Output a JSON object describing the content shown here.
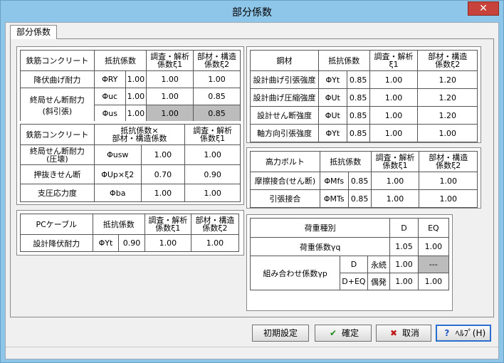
{
  "window": {
    "title": "部分係数",
    "close": "✕"
  },
  "tab": {
    "label": "部分係数"
  },
  "rc1": {
    "h": [
      "鉄筋コンクリート",
      "抵抗係数",
      "調査・解析\n係数ξ1",
      "部材・構造\n係数ξ2"
    ],
    "r1": [
      "降伏曲げ耐力",
      "ΦRY",
      "1.00",
      "1.00",
      "1.00"
    ],
    "r2label": "終局せん断耐力\n(斜引張)",
    "r2a": [
      "Φuc",
      "1.00",
      "1.00",
      "0.85"
    ],
    "r2b": [
      "Φus",
      "1.00",
      "1.00",
      "0.85"
    ]
  },
  "rc2": {
    "h": [
      "鉄筋コンクリート",
      "抵抗係数×\n部材・構造係数",
      "調査・解析\n係数ξ1"
    ],
    "r1": [
      "終局せん断耐力\n(圧壊)",
      "Φusw",
      "1.00",
      "1.00"
    ],
    "r2": [
      "押抜きせん断",
      "ΦUp×ξ2",
      "0.70",
      "0.90"
    ],
    "r3": [
      "支圧応力度",
      "Φba",
      "1.00",
      "1.00"
    ]
  },
  "pc": {
    "h": [
      "PCケーブル",
      "抵抗係数",
      "調査・解析\n係数ξ1",
      "部材・構造\n係数ξ2"
    ],
    "r1": [
      "設計降伏耐力",
      "ΦYt",
      "0.90",
      "1.00",
      "1.00"
    ]
  },
  "steel": {
    "h": [
      "鋼材",
      "抵抗係数",
      "調査・解析\nξ1",
      "部材・構造\n係数ξ2"
    ],
    "r1": [
      "設計曲げ引張強度",
      "ΦYt",
      "0.85",
      "1.00",
      "1.20"
    ],
    "r2": [
      "設計曲げ圧縮強度",
      "ΦUt",
      "0.85",
      "1.00",
      "1.20"
    ],
    "r3": [
      "設計せん断強度",
      "ΦUt",
      "0.85",
      "1.00",
      "1.20"
    ],
    "r4": [
      "軸方向引張強度",
      "ΦYt",
      "0.85",
      "1.00",
      "1.00"
    ]
  },
  "bolt": {
    "h": [
      "高力ボルト",
      "抵抗係数",
      "調査・解析\n係数ξ1",
      "部材・構造\n係数ξ2"
    ],
    "r1": [
      "摩擦接合(せん断)",
      "ΦMfs",
      "0.85",
      "1.00",
      "1.00"
    ],
    "r2": [
      "引張接合",
      "ΦMTs",
      "0.85",
      "1.00",
      "1.00"
    ]
  },
  "load": {
    "h": [
      "荷重種別",
      "D",
      "EQ"
    ],
    "r1": [
      "荷重係数γq",
      "1.05",
      "1.00"
    ],
    "r2label": "組み合わせ係数γp",
    "r2a": [
      "D",
      "永続",
      "1.00",
      "---"
    ],
    "r2b": [
      "D+EQ",
      "偶発",
      "1.00",
      "1.00"
    ]
  },
  "buttons": {
    "reset": "初期設定",
    "ok": "確定",
    "cancel": "取消",
    "help": "ﾍﾙﾌﾟ(H)"
  },
  "colors": {
    "titlebar": "#8ec6ea",
    "close": "#c7423a",
    "gray_cell": "#bcbcbc",
    "ok_icon": "#1a8a1a",
    "cancel_icon": "#c01818",
    "help_icon": "#1f56c8"
  }
}
